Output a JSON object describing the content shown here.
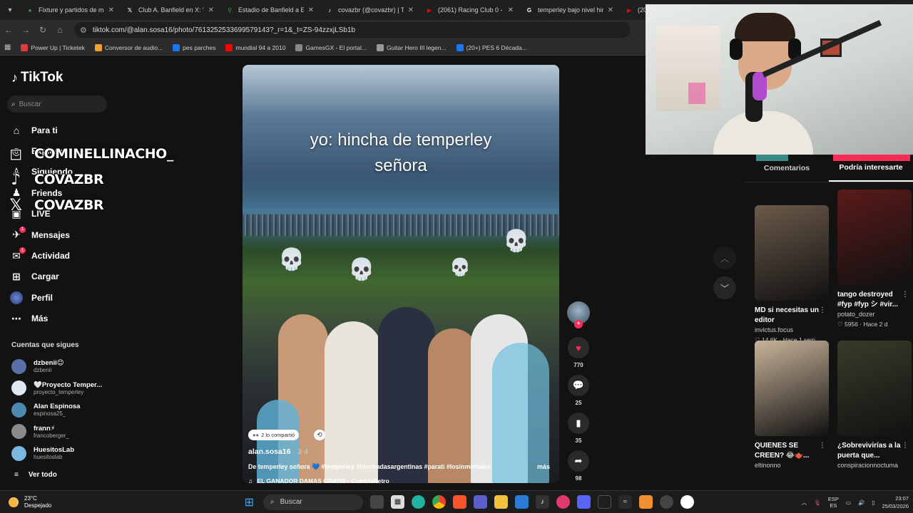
{
  "browser": {
    "tabs": [
      {
        "title": "Fixture y partidos de ma",
        "icon": "globe-icon",
        "color": "#3fa34d"
      },
      {
        "title": "Club A. Banfield en X: \"w",
        "icon": "x-icon",
        "color": "#ffffff"
      },
      {
        "title": "Estadio de Banfield a Esta",
        "icon": "maps-pin-icon",
        "color": "#34a853"
      },
      {
        "title": "covazbr (@covazbr) | Tik",
        "icon": "tiktok-icon",
        "color": "#ffffff"
      },
      {
        "title": "(2061) Racing Club 0 - 1",
        "icon": "youtube-icon",
        "color": "#ff0000"
      },
      {
        "title": "temperley bajo nivel hinc",
        "icon": "google-icon",
        "color": "#ffffff"
      },
      {
        "title": "(206",
        "icon": "youtube-icon",
        "color": "#ff0000"
      }
    ],
    "url": "tiktok.com/@alan.sosa16/photo/7613252533699579143?_r=1&_t=ZS-94zzxjLSb1b",
    "bookmarks": [
      {
        "label": "Power Up | Ticketek",
        "color": "#e03a3a"
      },
      {
        "label": "Conversor de audio...",
        "color": "#f0a030"
      },
      {
        "label": "pes parches",
        "color": "#1877f2"
      },
      {
        "label": "mundial 94 a 2010",
        "color": "#ff0000"
      },
      {
        "label": "GamesGX - El portal...",
        "color": "#888888"
      },
      {
        "label": "Guitar Hero III legen...",
        "color": "#999999"
      },
      {
        "label": "(20+) PES 6 Década...",
        "color": "#1877f2"
      }
    ]
  },
  "tiktok": {
    "brand": "TikTok",
    "search_placeholder": "Buscar",
    "nav": [
      {
        "label": "Para ti",
        "icon": "home-icon",
        "badge": ""
      },
      {
        "label": "Explorar",
        "icon": "compass-icon",
        "badge": ""
      },
      {
        "label": "Siguiendo",
        "icon": "following-icon",
        "badge": ""
      },
      {
        "label": "Friends",
        "icon": "friends-icon",
        "badge": ""
      },
      {
        "label": "LIVE",
        "icon": "live-icon",
        "badge": ""
      },
      {
        "label": "Mensajes",
        "icon": "message-icon",
        "badge": "1"
      },
      {
        "label": "Actividad",
        "icon": "activity-icon",
        "badge": "1"
      },
      {
        "label": "Cargar",
        "icon": "upload-icon",
        "badge": ""
      },
      {
        "label": "Perfil",
        "icon": "profile-icon",
        "badge": ""
      },
      {
        "label": "Más",
        "icon": "more-icon",
        "badge": ""
      }
    ],
    "following_title": "Cuentas que sigues",
    "accounts": [
      {
        "name": "dzbenii😊",
        "handle": "dzbenii",
        "color": "#5a6fa8"
      },
      {
        "name": "🤍Proyecto Temper...",
        "handle": "proyecto_temperley",
        "color": "#dfe8f0"
      },
      {
        "name": "Alan Espinosa",
        "handle": "espinosa25_",
        "color": "#4d8ab0"
      },
      {
        "name": "frann⚡",
        "handle": "francoberger_",
        "color": "#8a8a8a"
      },
      {
        "name": "HuesitosLab",
        "handle": "huesitoslab",
        "color": "#7ab8e0"
      }
    ],
    "see_all": "Ver todo"
  },
  "overlay": {
    "socials": [
      {
        "handle": "COMINELLINACHO_",
        "icon": "instagram-icon"
      },
      {
        "handle": "COVAZBR",
        "icon": "tiktok-icon"
      },
      {
        "handle": "COVAZBR",
        "icon": "x-icon"
      }
    ]
  },
  "post": {
    "caption_line1": "yo: hincha de temperley",
    "caption_line2": "señora",
    "shared_label": "2 lo compartió",
    "author": "alan.sosa16",
    "date": " · 3-4",
    "description": "De temperley señora 💙 #temperley #hinchadasargentinas #parati #losinmortales",
    "more": "más",
    "music": "EL GANADOR DAMAS GRATIS - CumbiaRetro_",
    "likes": "770",
    "comments": "25",
    "saves": "35",
    "shares": "98"
  },
  "panel": {
    "tab_comments": "Comentarios",
    "tab_related": "Podría interesarte",
    "cards": [
      {
        "title": "MD si necesitas un editor",
        "author": "invictus.focus",
        "meta": "♡ 14.6K · Hace 1 sem.",
        "color": "#6b5a4a"
      },
      {
        "title": "tango destroyed #fyp #fyp シ #vir...",
        "author": "potato_dozer",
        "meta": "♡ 5956 · Hace 2 d",
        "color": "#5a1a1a"
      },
      {
        "title": "QUIENES SE CREEN? 😂🫖...",
        "author": "eltinonno",
        "meta": "",
        "color": "#c9b49a"
      },
      {
        "title": "¿Sobrevivirías a la puerta que...",
        "author": "conspiracionnoctuma",
        "meta": "",
        "color": "#3a3a2a"
      }
    ]
  },
  "taskbar": {
    "temperature": "23°C",
    "weather": "Despejado",
    "search": "Buscar",
    "lang1": "ESP",
    "lang2": "ES",
    "time": "23:07",
    "date": "25/03/2026"
  }
}
